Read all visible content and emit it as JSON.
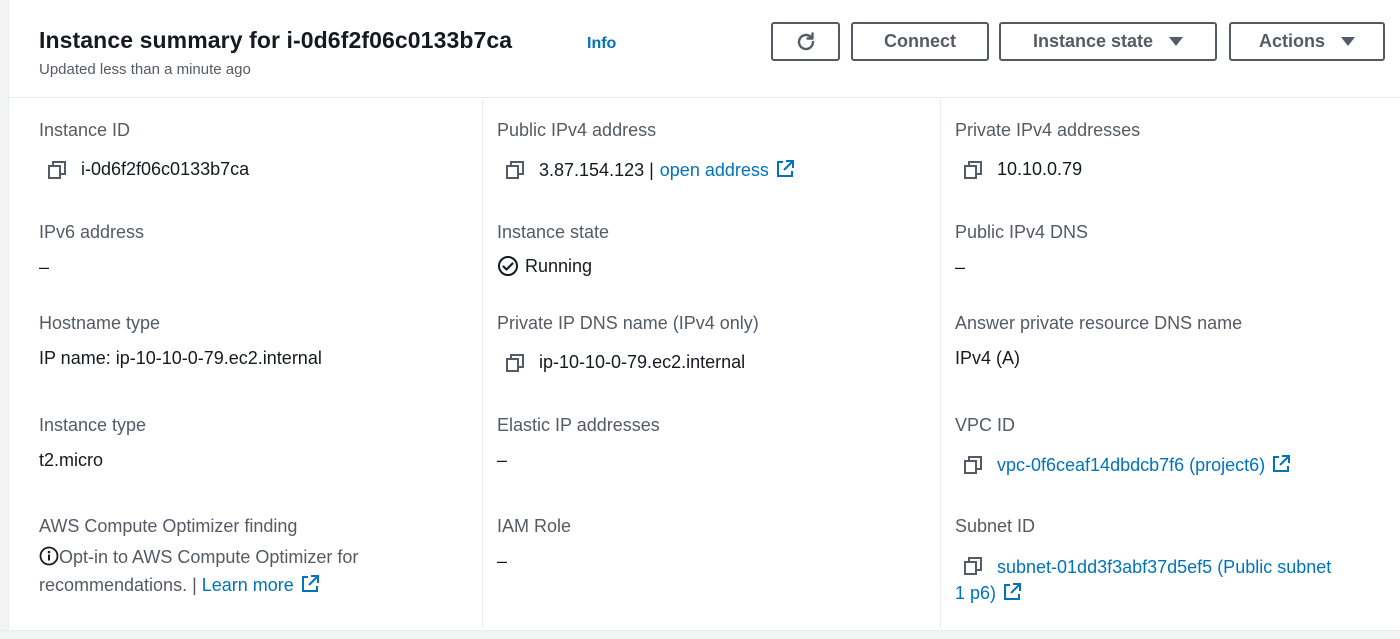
{
  "header": {
    "title": "Instance summary for i-0d6f2f06c0133b7ca",
    "info": "Info",
    "subtitle": "Updated less than a minute ago",
    "buttons": {
      "connect": "Connect",
      "instance_state": "Instance state",
      "actions": "Actions"
    }
  },
  "fields": {
    "instance_id": {
      "label": "Instance ID",
      "value": "i-0d6f2f06c0133b7ca"
    },
    "public_ipv4": {
      "label": "Public IPv4 address",
      "value": "3.87.154.123 |",
      "link": "open address"
    },
    "private_ipv4": {
      "label": "Private IPv4 addresses",
      "value": "10.10.0.79"
    },
    "ipv6": {
      "label": "IPv6 address",
      "value": "–"
    },
    "instance_state": {
      "label": "Instance state",
      "value": "Running"
    },
    "public_dns": {
      "label": "Public IPv4 DNS",
      "value": "–"
    },
    "hostname_type": {
      "label": "Hostname type",
      "value": "IP name: ip-10-10-0-79.ec2.internal"
    },
    "private_dns": {
      "label": "Private IP DNS name (IPv4 only)",
      "value": "ip-10-10-0-79.ec2.internal"
    },
    "answer_dns": {
      "label": "Answer private resource DNS name",
      "value": "IPv4 (A)"
    },
    "instance_type": {
      "label": "Instance type",
      "value": "t2.micro"
    },
    "elastic_ip": {
      "label": "Elastic IP addresses",
      "value": "–"
    },
    "vpc_id": {
      "label": "VPC ID",
      "value": "vpc-0f6ceaf14dbdcb7f6 (project6)"
    },
    "optimizer": {
      "label": "AWS Compute Optimizer finding",
      "value": "Opt-in to AWS Compute Optimizer for recommendations. |",
      "link": "Learn more"
    },
    "iam_role": {
      "label": "IAM Role",
      "value": "–"
    },
    "subnet_id": {
      "label": "Subnet ID",
      "value_line1": "subnet-01dd3f3abf37d5ef5 (Public subnet",
      "value_line2": "1 p6)"
    }
  },
  "icons": {
    "copy": "copy-icon",
    "external": "external-link-icon",
    "refresh": "refresh-icon",
    "status": "check-circle-icon",
    "info": "info-circle-icon"
  },
  "colors": {
    "link": "#0073bb",
    "text": "#16191f",
    "muted": "#545b64"
  }
}
